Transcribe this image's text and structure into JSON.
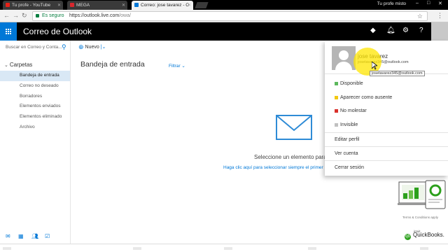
{
  "browser": {
    "tabs": [
      {
        "title": "Tu profe - YouTube",
        "icon": "youtube-icon",
        "color": "#e62117"
      },
      {
        "title": "MEGA",
        "icon": "mega-icon",
        "color": "#d9272e"
      },
      {
        "title": "Correo: jose tavarez - O",
        "icon": "outlook-icon",
        "color": "#0078d7",
        "active": true
      }
    ],
    "profile_name": "Tu profe misto",
    "secure_label": "Es seguro",
    "url_host": "https://outlook.live.com",
    "url_path": "/owa/"
  },
  "header": {
    "app_title": "Correo de Outlook",
    "accent": "#0078d7"
  },
  "search": {
    "placeholder": "Buscar en Correo y Conta..."
  },
  "toolbar": {
    "new_label": "Nuevo"
  },
  "folders": {
    "header": "Carpetas",
    "items": [
      {
        "label": "Bandeja de entrada",
        "selected": true
      },
      {
        "label": "Correo no deseado"
      },
      {
        "label": "Borradores"
      },
      {
        "label": "Elementos enviados"
      },
      {
        "label": "Elementos eliminado"
      },
      {
        "label": "Archivo"
      }
    ]
  },
  "mail_list": {
    "title": "Bandeja de entrada",
    "filter_label": "Filtrar"
  },
  "reading_pane": {
    "empty_message": "Seleccione un elemento para",
    "hint": "Haga clic aquí para seleccionar siempre el primer"
  },
  "account_menu": {
    "user_name": "jose tavarez",
    "email": "josetavarez345@outlook.com",
    "tooltip": "josetavarez345@outlook.com",
    "statuses": [
      {
        "label": "Disponible",
        "color": "#5cb85c"
      },
      {
        "label": "Aparecer como ausente",
        "color": "#f2c811"
      },
      {
        "label": "No molestar",
        "color": "#d9312b"
      },
      {
        "label": "Invisible",
        "color": "#c0c0c0"
      }
    ],
    "edit_profile": "Editar perfil",
    "view_account": "Ver cuenta",
    "sign_out": "Cerrar sesión"
  },
  "ad": {
    "terms": "Terms & Conditions apply",
    "brand_small": "intuit",
    "brand": "QuickBooks."
  }
}
